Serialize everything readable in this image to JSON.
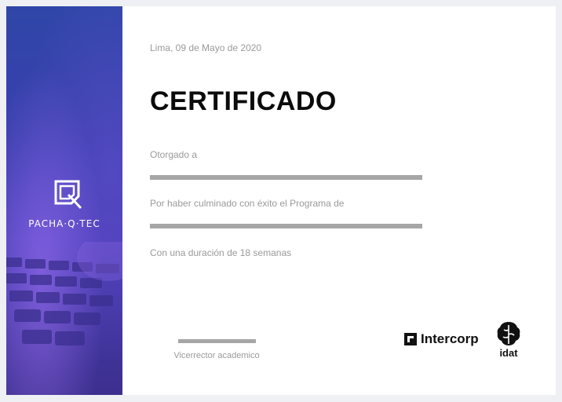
{
  "certificate": {
    "date": "Lima, 09 de Mayo de 2020",
    "title": "CERTIFICADO",
    "awarded_label": "Otorgado a",
    "program_label": "Por haber culminado con éxito el Programa de",
    "duration_label": "Con una duración de 18 semanas",
    "signature_label": "Vicerrector academico"
  },
  "sidebar": {
    "brand_name": "PACHA·Q·TEC",
    "logo_icon": "pachaqtec-logo-icon"
  },
  "partners": {
    "intercorp": "Intercorp",
    "idat": "idat"
  },
  "colors": {
    "sidebar_top": "#2f46a8",
    "sidebar_bottom": "#3c2f8e",
    "title": "#0b0b0b",
    "placeholder_line": "#a6a6a6",
    "muted_text": "#9a9a9a"
  }
}
